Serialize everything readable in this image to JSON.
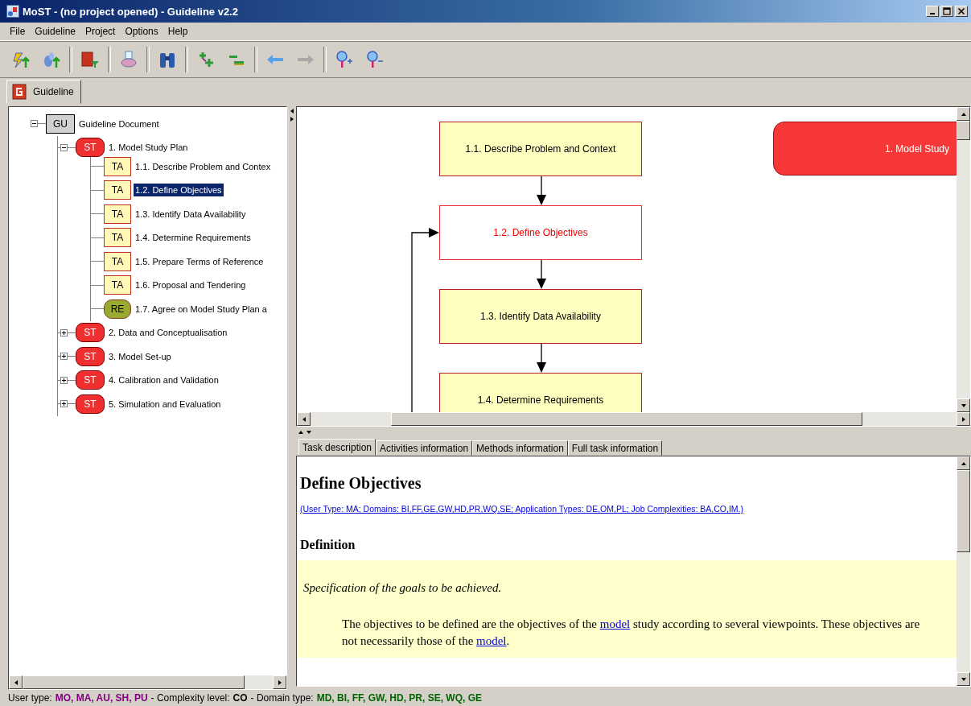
{
  "window": {
    "title": "MoST - (no project opened) - Guideline v2.2"
  },
  "menu": [
    {
      "label": "File"
    },
    {
      "label": "Guideline"
    },
    {
      "label": "Project"
    },
    {
      "label": "Options"
    },
    {
      "label": "Help"
    }
  ],
  "toolbar": [
    [
      {
        "kind": "import-drop",
        "disabled": false
      },
      {
        "kind": "import-drops",
        "disabled": false
      }
    ],
    [
      {
        "kind": "book-filter",
        "disabled": false
      }
    ],
    [
      {
        "kind": "printer",
        "disabled": false
      }
    ],
    [
      {
        "kind": "binoculars",
        "disabled": false
      }
    ],
    [
      {
        "kind": "expand",
        "disabled": false
      },
      {
        "kind": "collapse",
        "disabled": false
      }
    ],
    [
      {
        "kind": "back",
        "disabled": false
      },
      {
        "kind": "forward",
        "disabled": true
      }
    ],
    [
      {
        "kind": "zoom-in",
        "disabled": false
      },
      {
        "kind": "zoom-out",
        "disabled": false
      }
    ]
  ],
  "doc_tabs": [
    {
      "label": "Guideline",
      "selected": true
    }
  ],
  "tree": {
    "badge": "GU",
    "kind": "document",
    "label": "Guideline Document",
    "expanded": true,
    "selected": false,
    "children": [
      {
        "badge": "ST",
        "kind": "stage",
        "label": "1. Model Study Plan",
        "expanded": true,
        "selected": false,
        "children": [
          {
            "badge": "TA",
            "kind": "task",
            "label": "1.1. Describe Problem and Contex",
            "selected": false
          },
          {
            "badge": "TA",
            "kind": "task",
            "label": "1.2. Define Objectives",
            "selected": true
          },
          {
            "badge": "TA",
            "kind": "task",
            "label": "1.3. Identify Data Availability",
            "selected": false
          },
          {
            "badge": "TA",
            "kind": "task",
            "label": "1.4. Determine Requirements",
            "selected": false
          },
          {
            "badge": "TA",
            "kind": "task",
            "label": "1.5. Prepare Terms of Reference",
            "selected": false
          },
          {
            "badge": "TA",
            "kind": "task",
            "label": "1.6. Proposal and Tendering",
            "selected": false
          },
          {
            "badge": "RE",
            "kind": "result",
            "label": "1.7. Agree on Model Study Plan a",
            "selected": false
          }
        ]
      },
      {
        "badge": "ST",
        "kind": "stage",
        "label": "2. Data and Conceptualisation",
        "expanded": false,
        "selected": false
      },
      {
        "badge": "ST",
        "kind": "stage",
        "label": "3. Model Set-up",
        "expanded": false,
        "selected": false
      },
      {
        "badge": "ST",
        "kind": "stage",
        "label": "4. Calibration and Validation",
        "expanded": false,
        "selected": false
      },
      {
        "badge": "ST",
        "kind": "stage",
        "label": "5. Simulation and Evaluation",
        "expanded": false,
        "selected": false
      }
    ]
  },
  "diagram": {
    "nodes": [
      {
        "label": "1.1. Describe Problem and Context",
        "kind": "task"
      },
      {
        "label": "1.2. Define Objectives",
        "kind": "current"
      },
      {
        "label": "1.3. Identify Data Availability",
        "kind": "task"
      },
      {
        "label": "1.4. Determine Requirements",
        "kind": "task"
      },
      {
        "label": "1. Model Study",
        "kind": "stage"
      }
    ]
  },
  "info_tabs": [
    {
      "label": "Task description",
      "selected": true
    },
    {
      "label": "Activities information",
      "selected": false
    },
    {
      "label": "Methods information",
      "selected": false
    },
    {
      "label": "Full task information",
      "selected": false
    }
  ],
  "task": {
    "title": "Define Objectives",
    "meta_link": "(User Type: MA; Domains: BI,FF,GE,GW,HD,PR,WQ,SE; Application Types: DE,OM,PL; Job Complexities: BA,CO,IM.)",
    "section": "Definition",
    "summary": "Specification of the goals to be achieved.",
    "paragraph": [
      {
        "kind": "text",
        "text": "The objectives to be defined are the objectives of the "
      },
      {
        "kind": "link",
        "text": "model"
      },
      {
        "kind": "text",
        "text": " study according to several viewpoints.  These objectives are not necessarily those of the "
      },
      {
        "kind": "link",
        "text": "model"
      },
      {
        "kind": "text",
        "text": "."
      }
    ]
  },
  "status_bar": [
    {
      "label": "User type:",
      "value": "MO, MA, AU, SH, PU",
      "color": "#800080"
    },
    {
      "label": "- Complexity level:",
      "value": "CO",
      "color": "#000000"
    },
    {
      "label": "- Domain type:",
      "value": "MD, BI, FF, GW, HD, PR, SE, WQ, GE",
      "color": "#006400"
    }
  ]
}
